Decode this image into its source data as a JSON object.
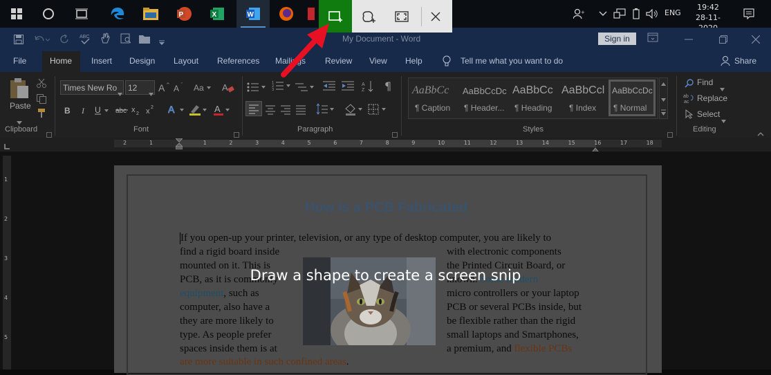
{
  "taskbar": {
    "time": "19:42",
    "date": "28-11-2020",
    "language": "ENG"
  },
  "word": {
    "title": "My Document  -  Word",
    "sign_in": "Sign in",
    "tabs": [
      "File",
      "Home",
      "Insert",
      "Design",
      "Layout",
      "References",
      "Mailings",
      "Review",
      "View",
      "Help"
    ],
    "tell_me": "Tell me what you want to do",
    "share": "Share",
    "font_name": "Times New Ro",
    "font_size": "12",
    "paste": "Paste",
    "groups": {
      "clipboard": "Clipboard",
      "font": "Font",
      "paragraph": "Paragraph",
      "styles": "Styles",
      "editing": "Editing"
    },
    "styles": [
      {
        "sample": "AaBbCc",
        "name": "¶ Caption"
      },
      {
        "sample": "AaBbCcDc",
        "name": "¶ Header..."
      },
      {
        "sample": "AaBbCc",
        "name": "¶ Heading"
      },
      {
        "sample": "AaBbCcl",
        "name": "¶ Index"
      },
      {
        "sample": "AaBbCcDc",
        "name": "¶ Normal"
      }
    ],
    "editing": {
      "find": "Find",
      "replace": "Replace",
      "select": "Select"
    },
    "ruler_numbers": [
      "2",
      "1",
      "1",
      "2",
      "3",
      "4",
      "5",
      "6",
      "7",
      "8",
      "9",
      "10",
      "11",
      "12",
      "13",
      "14",
      "15",
      "16",
      "17",
      "18"
    ],
    "vruler_numbers": [
      "1",
      "2",
      "3",
      "4",
      "5"
    ]
  },
  "document": {
    "heading": "How is a PCB Fabricated",
    "line1": "If you open-up your printer, television, or any type of desktop computer, you are likely to",
    "left_lines": [
      "find a rigid board inside",
      "mounted on it. This is",
      "PCB, as it is commonly",
      "",
      "computer, also have a",
      "they are more likely to",
      "type. As people prefer",
      "spaces inside them is at"
    ],
    "left_blue": "equipment",
    "left_after_blue": ", such as",
    "right_lines": [
      "with electronic components",
      "the Printed Circuit Board, or",
      "",
      "micro controllers or your laptop",
      "PCB or several PCBs inside, but",
      "be flexible rather than the rigid",
      "small laptops and Smartphones,"
    ],
    "right_pre_blue": "known. ",
    "right_blue": "Some modern",
    "last_right_pre": "a premium, and ",
    "last_right_orange": "flexible PCBs",
    "last_line_orange": "are more suitable in such confined areas",
    "last_line_end": "."
  },
  "snip": {
    "message": "Draw a shape to create a screen snip"
  },
  "colors": {
    "accent_green": "#107c10",
    "word_blue": "#172a4a",
    "arrow_red": "#e81123"
  }
}
